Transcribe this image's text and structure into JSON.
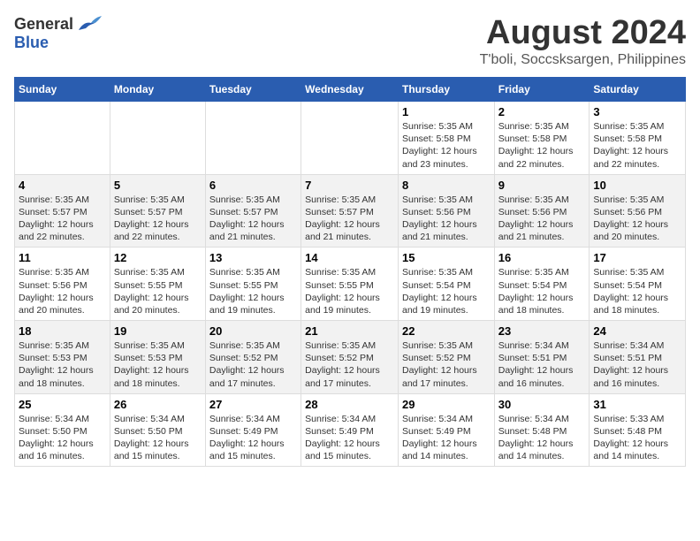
{
  "header": {
    "logo_general": "General",
    "logo_blue": "Blue",
    "month": "August 2024",
    "location": "T'boli, Soccsksargen, Philippines"
  },
  "days_of_week": [
    "Sunday",
    "Monday",
    "Tuesday",
    "Wednesday",
    "Thursday",
    "Friday",
    "Saturday"
  ],
  "weeks": [
    [
      {
        "day": "",
        "sunrise": "",
        "sunset": "",
        "daylight": ""
      },
      {
        "day": "",
        "sunrise": "",
        "sunset": "",
        "daylight": ""
      },
      {
        "day": "",
        "sunrise": "",
        "sunset": "",
        "daylight": ""
      },
      {
        "day": "",
        "sunrise": "",
        "sunset": "",
        "daylight": ""
      },
      {
        "day": "1",
        "sunrise": "Sunrise: 5:35 AM",
        "sunset": "Sunset: 5:58 PM",
        "daylight": "Daylight: 12 hours and 23 minutes."
      },
      {
        "day": "2",
        "sunrise": "Sunrise: 5:35 AM",
        "sunset": "Sunset: 5:58 PM",
        "daylight": "Daylight: 12 hours and 22 minutes."
      },
      {
        "day": "3",
        "sunrise": "Sunrise: 5:35 AM",
        "sunset": "Sunset: 5:58 PM",
        "daylight": "Daylight: 12 hours and 22 minutes."
      }
    ],
    [
      {
        "day": "4",
        "sunrise": "Sunrise: 5:35 AM",
        "sunset": "Sunset: 5:57 PM",
        "daylight": "Daylight: 12 hours and 22 minutes."
      },
      {
        "day": "5",
        "sunrise": "Sunrise: 5:35 AM",
        "sunset": "Sunset: 5:57 PM",
        "daylight": "Daylight: 12 hours and 22 minutes."
      },
      {
        "day": "6",
        "sunrise": "Sunrise: 5:35 AM",
        "sunset": "Sunset: 5:57 PM",
        "daylight": "Daylight: 12 hours and 21 minutes."
      },
      {
        "day": "7",
        "sunrise": "Sunrise: 5:35 AM",
        "sunset": "Sunset: 5:57 PM",
        "daylight": "Daylight: 12 hours and 21 minutes."
      },
      {
        "day": "8",
        "sunrise": "Sunrise: 5:35 AM",
        "sunset": "Sunset: 5:56 PM",
        "daylight": "Daylight: 12 hours and 21 minutes."
      },
      {
        "day": "9",
        "sunrise": "Sunrise: 5:35 AM",
        "sunset": "Sunset: 5:56 PM",
        "daylight": "Daylight: 12 hours and 21 minutes."
      },
      {
        "day": "10",
        "sunrise": "Sunrise: 5:35 AM",
        "sunset": "Sunset: 5:56 PM",
        "daylight": "Daylight: 12 hours and 20 minutes."
      }
    ],
    [
      {
        "day": "11",
        "sunrise": "Sunrise: 5:35 AM",
        "sunset": "Sunset: 5:56 PM",
        "daylight": "Daylight: 12 hours and 20 minutes."
      },
      {
        "day": "12",
        "sunrise": "Sunrise: 5:35 AM",
        "sunset": "Sunset: 5:55 PM",
        "daylight": "Daylight: 12 hours and 20 minutes."
      },
      {
        "day": "13",
        "sunrise": "Sunrise: 5:35 AM",
        "sunset": "Sunset: 5:55 PM",
        "daylight": "Daylight: 12 hours and 19 minutes."
      },
      {
        "day": "14",
        "sunrise": "Sunrise: 5:35 AM",
        "sunset": "Sunset: 5:55 PM",
        "daylight": "Daylight: 12 hours and 19 minutes."
      },
      {
        "day": "15",
        "sunrise": "Sunrise: 5:35 AM",
        "sunset": "Sunset: 5:54 PM",
        "daylight": "Daylight: 12 hours and 19 minutes."
      },
      {
        "day": "16",
        "sunrise": "Sunrise: 5:35 AM",
        "sunset": "Sunset: 5:54 PM",
        "daylight": "Daylight: 12 hours and 18 minutes."
      },
      {
        "day": "17",
        "sunrise": "Sunrise: 5:35 AM",
        "sunset": "Sunset: 5:54 PM",
        "daylight": "Daylight: 12 hours and 18 minutes."
      }
    ],
    [
      {
        "day": "18",
        "sunrise": "Sunrise: 5:35 AM",
        "sunset": "Sunset: 5:53 PM",
        "daylight": "Daylight: 12 hours and 18 minutes."
      },
      {
        "day": "19",
        "sunrise": "Sunrise: 5:35 AM",
        "sunset": "Sunset: 5:53 PM",
        "daylight": "Daylight: 12 hours and 18 minutes."
      },
      {
        "day": "20",
        "sunrise": "Sunrise: 5:35 AM",
        "sunset": "Sunset: 5:52 PM",
        "daylight": "Daylight: 12 hours and 17 minutes."
      },
      {
        "day": "21",
        "sunrise": "Sunrise: 5:35 AM",
        "sunset": "Sunset: 5:52 PM",
        "daylight": "Daylight: 12 hours and 17 minutes."
      },
      {
        "day": "22",
        "sunrise": "Sunrise: 5:35 AM",
        "sunset": "Sunset: 5:52 PM",
        "daylight": "Daylight: 12 hours and 17 minutes."
      },
      {
        "day": "23",
        "sunrise": "Sunrise: 5:34 AM",
        "sunset": "Sunset: 5:51 PM",
        "daylight": "Daylight: 12 hours and 16 minutes."
      },
      {
        "day": "24",
        "sunrise": "Sunrise: 5:34 AM",
        "sunset": "Sunset: 5:51 PM",
        "daylight": "Daylight: 12 hours and 16 minutes."
      }
    ],
    [
      {
        "day": "25",
        "sunrise": "Sunrise: 5:34 AM",
        "sunset": "Sunset: 5:50 PM",
        "daylight": "Daylight: 12 hours and 16 minutes."
      },
      {
        "day": "26",
        "sunrise": "Sunrise: 5:34 AM",
        "sunset": "Sunset: 5:50 PM",
        "daylight": "Daylight: 12 hours and 15 minutes."
      },
      {
        "day": "27",
        "sunrise": "Sunrise: 5:34 AM",
        "sunset": "Sunset: 5:49 PM",
        "daylight": "Daylight: 12 hours and 15 minutes."
      },
      {
        "day": "28",
        "sunrise": "Sunrise: 5:34 AM",
        "sunset": "Sunset: 5:49 PM",
        "daylight": "Daylight: 12 hours and 15 minutes."
      },
      {
        "day": "29",
        "sunrise": "Sunrise: 5:34 AM",
        "sunset": "Sunset: 5:49 PM",
        "daylight": "Daylight: 12 hours and 14 minutes."
      },
      {
        "day": "30",
        "sunrise": "Sunrise: 5:34 AM",
        "sunset": "Sunset: 5:48 PM",
        "daylight": "Daylight: 12 hours and 14 minutes."
      },
      {
        "day": "31",
        "sunrise": "Sunrise: 5:33 AM",
        "sunset": "Sunset: 5:48 PM",
        "daylight": "Daylight: 12 hours and 14 minutes."
      }
    ]
  ]
}
